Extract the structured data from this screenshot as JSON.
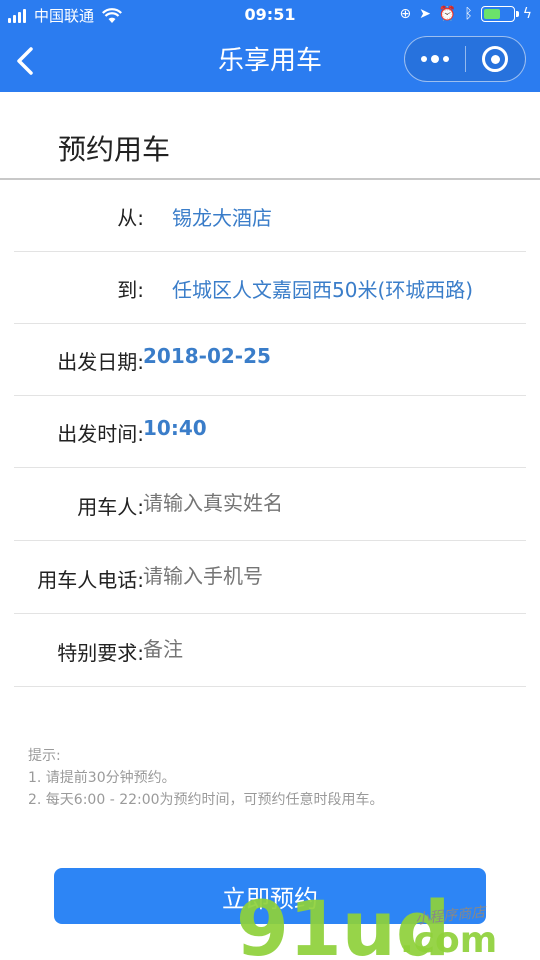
{
  "status_bar": {
    "carrier": "中国联通",
    "time": "09:51"
  },
  "nav": {
    "title": "乐享用车"
  },
  "section": {
    "title": "预约用车"
  },
  "form": {
    "from": {
      "label": "从:",
      "value": "锡龙大酒店"
    },
    "to": {
      "label": "到:",
      "value": "任城区人文嘉园西50米(环城西路)"
    },
    "date": {
      "label": "出发日期:",
      "value": "2018-02-25"
    },
    "time": {
      "label": "出发时间:",
      "value": "10:40"
    },
    "user": {
      "label": "用车人:",
      "placeholder": "请输入真实姓名"
    },
    "phone": {
      "label": "用车人电话:",
      "placeholder": "请输入手机号"
    },
    "notes": {
      "label": "特别要求:",
      "placeholder": "备注"
    }
  },
  "tips": {
    "heading": "提示:",
    "line1": "1. 请提前30分钟预约。",
    "line2": "2. 每天6:00 - 22:00为预约时间，可预约任意时段用车。"
  },
  "submit_label": "立即预约",
  "watermark": {
    "brand": "91ud",
    "domain": ".com",
    "tagline": "小程序商店"
  },
  "colors": {
    "primary": "#2b7cf0",
    "value_text": "#3a7dc9",
    "button": "#2d85f5",
    "watermark_green": "#8fd13a"
  }
}
